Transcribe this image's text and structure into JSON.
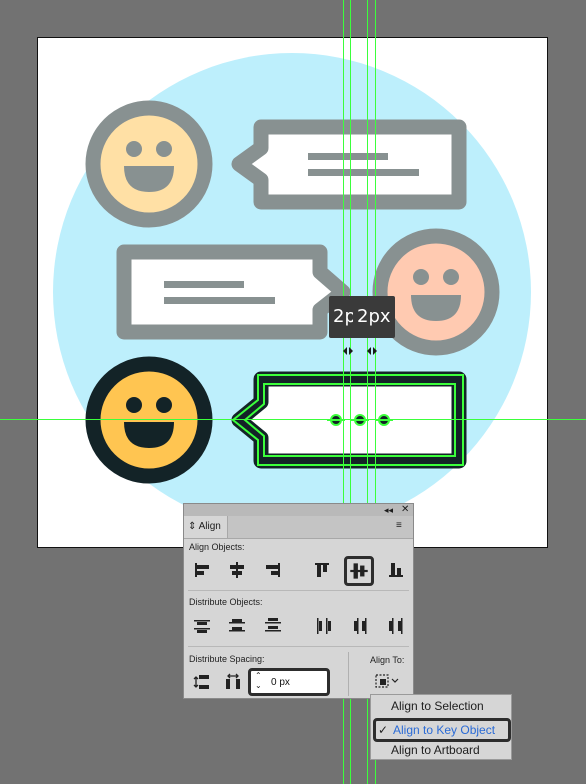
{
  "tooltip": {
    "left_label": "2p",
    "right_label": "2px"
  },
  "align_panel": {
    "tab_label": "Align",
    "align_objects_label": "Align Objects:",
    "distribute_objects_label": "Distribute Objects:",
    "distribute_spacing_label": "Distribute Spacing:",
    "align_to_label": "Align To:",
    "spacing_value": "0 px"
  },
  "align_to_menu": {
    "items": [
      "Align to Selection",
      "Align to Key Object",
      "Align to Artboard"
    ],
    "selected": "Align to Key Object",
    "check": "✓"
  },
  "colors": {
    "canvas": "#727272",
    "circle_bg": "#bdeffc",
    "frame_gray": "#889191",
    "smiley_yellow_light": "#ffe0a5",
    "smiley_peach": "#ffcab1",
    "smiley_yellow": "#ffc551",
    "dark_outline": "#132327",
    "guide_green": "#3bff3b",
    "menu_highlight": "#2a6bd6"
  }
}
